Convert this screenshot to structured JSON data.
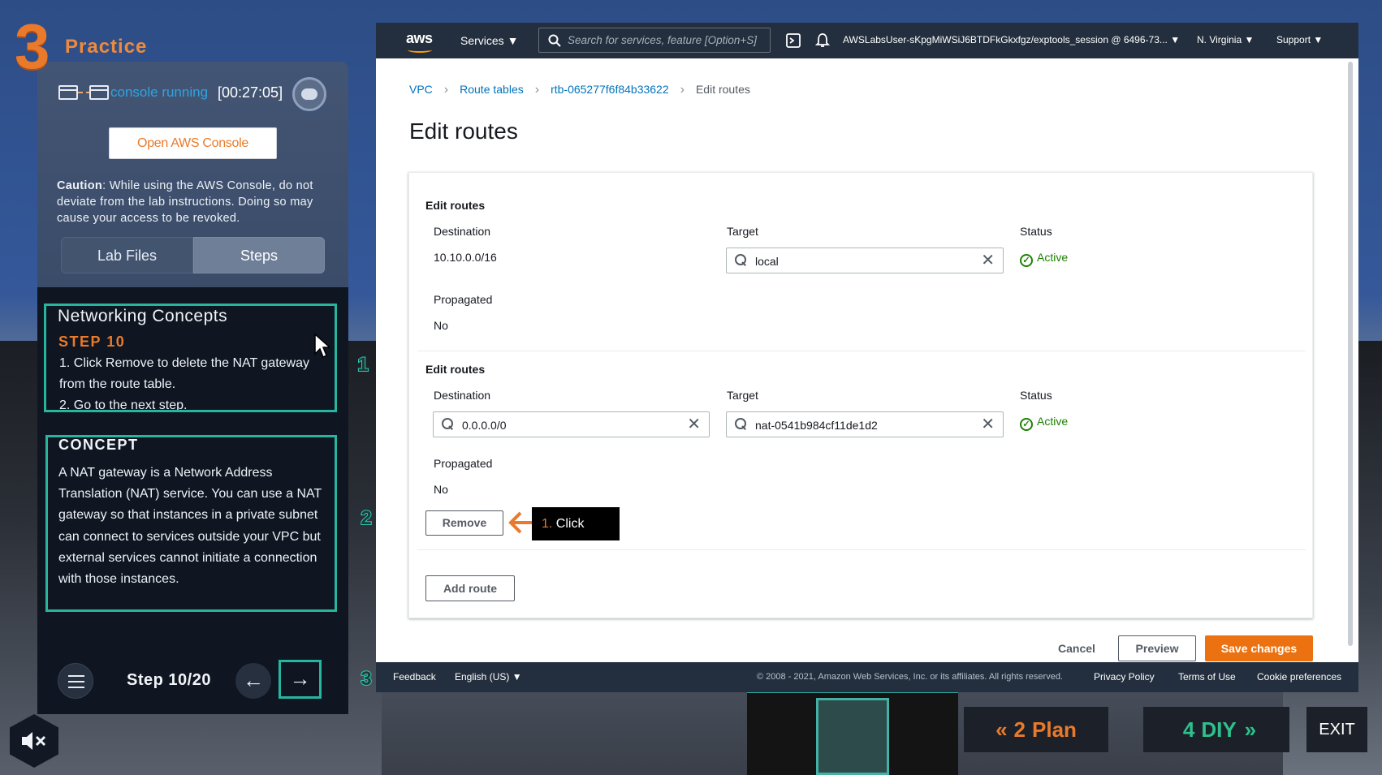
{
  "app": {
    "logo_number": "3",
    "section_label": "Practice"
  },
  "console_status": {
    "label": "console running",
    "timer": "[00:27:05]",
    "open_button": "Open AWS Console"
  },
  "caution": {
    "bold": "Caution",
    "text": ": While using the AWS Console, do not deviate from the lab instructions. Doing so may cause your access to be revoked."
  },
  "tabs": {
    "lab_files": "Lab Files",
    "steps": "Steps"
  },
  "step_box": {
    "title": "Networking Concepts",
    "step": "STEP 10",
    "lines": [
      "1.  Click Remove to delete the NAT gateway from the route table.",
      "2.  Go to the next step."
    ]
  },
  "concept": {
    "heading": "CONCEPT",
    "text": "A NAT gateway is a Network Address Translation (NAT) service. You can use a NAT gateway so that instances in a private subnet can connect to services outside your VPC but external services cannot initiate a connection with those instances."
  },
  "badges": [
    "1",
    "2",
    "3"
  ],
  "step_nav": {
    "counter": "Step 10/20",
    "prev": "←",
    "next": "→"
  },
  "aws_topbar": {
    "logo": "aws",
    "services": "Services ▼",
    "search_placeholder": "Search for services, feature [Option+S]",
    "user": "AWSLabsUser-sKpgMiWSiJ6BTDFkGkxfgz/exptools_session @ 6496-73... ▼",
    "region": "N. Virginia ▼",
    "support": "Support ▼"
  },
  "breadcrumbs": [
    "VPC",
    "Route tables",
    "rtb-065277f6f84b33622",
    "Edit routes"
  ],
  "page_title": "Edit routes",
  "routes": [
    {
      "section": "Edit routes",
      "destination_label": "Destination",
      "destination": "10.10.0.0/16",
      "target_label": "Target",
      "target": "local",
      "status_label": "Status",
      "status": "Active",
      "propagated_label": "Propagated",
      "propagated": "No"
    },
    {
      "section": "Edit routes",
      "destination_label": "Destination",
      "destination": "0.0.0.0/0",
      "target_label": "Target",
      "target": "nat-0541b984cf11de1d2",
      "status_label": "Status",
      "status": "Active",
      "propagated_label": "Propagated",
      "propagated": "No"
    }
  ],
  "remove_button": "Remove",
  "callout": {
    "num": "1.",
    "text": " Click"
  },
  "add_route_button": "Add route",
  "actions": {
    "cancel": "Cancel",
    "preview": "Preview",
    "save": "Save changes"
  },
  "footer": {
    "feedback": "Feedback",
    "language": "English (US) ▼",
    "copyright": "© 2008 - 2021, Amazon Web Services, Inc. or its affiliates. All rights reserved.",
    "privacy": "Privacy Policy",
    "terms": "Terms of Use",
    "cookies": "Cookie preferences"
  },
  "bottom_nav": {
    "plan_num": "2",
    "plan": "Plan",
    "diy_num": "4",
    "diy": "DIY",
    "exit": "EXIT"
  },
  "colors": {
    "accent_orange": "#ea7a2b",
    "teal": "#27b59e",
    "aws_dark": "#232f3e",
    "active_green": "#1d8102"
  }
}
